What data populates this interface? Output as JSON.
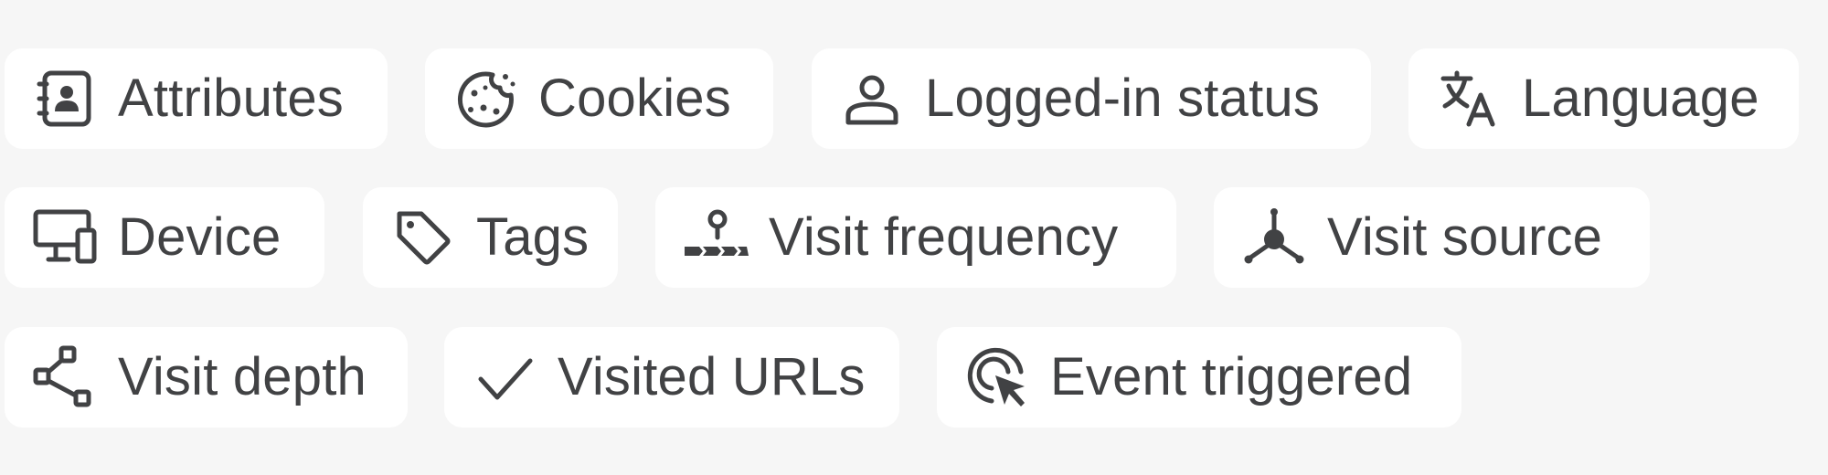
{
  "filters": [
    {
      "label": "Attributes",
      "icon": "contact-book-icon"
    },
    {
      "label": "Cookies",
      "icon": "cookie-icon"
    },
    {
      "label": "Logged-in status",
      "icon": "user-icon"
    },
    {
      "label": "Language",
      "icon": "translate-icon"
    },
    {
      "label": "Device",
      "icon": "devices-icon"
    },
    {
      "label": "Tags",
      "icon": "tag-icon"
    },
    {
      "label": "Visit frequency",
      "icon": "route-pin-icon"
    },
    {
      "label": "Visit source",
      "icon": "network-node-icon"
    },
    {
      "label": "Visit depth",
      "icon": "tree-structure-icon"
    },
    {
      "label": "Visited URLs",
      "icon": "checkmark-icon"
    },
    {
      "label": "Event triggered",
      "icon": "cursor-click-icon"
    }
  ],
  "colors": {
    "page_background": "#f6f6f6",
    "chip_background": "#ffffff",
    "text": "#414244"
  }
}
